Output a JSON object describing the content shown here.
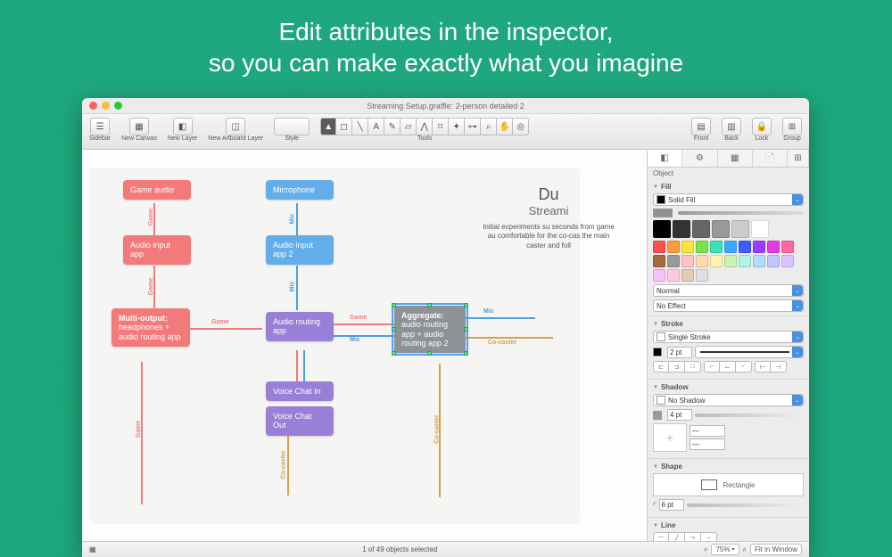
{
  "headline": {
    "line1": "Edit attributes in the inspector,",
    "line2": "so you can make exactly what you imagine"
  },
  "window": {
    "title": "Streaming Setup.graffle: 2-person detailed 2"
  },
  "toolbar": {
    "sidebar": "Sidebar",
    "newCanvas": "New Canvas",
    "newLayer": "New Layer",
    "newArtboard": "New Artboard Layer",
    "style": "Style",
    "tools": "Tools",
    "front": "Front",
    "back": "Back",
    "lock": "Lock",
    "group": "Group"
  },
  "canvas": {
    "nodes": {
      "gameAudio": "Game audio",
      "microphone": "Microphone",
      "audioInput1a": "Audio input",
      "audioInput1b": "app",
      "audioInput2a": "Audio input",
      "audioInput2b": "app 2",
      "multiA": "Multi-output:",
      "multiB": "headphones + audio routing app",
      "routingA": "Audio routing",
      "routingB": "app",
      "aggA": "Aggregate:",
      "aggB": "audio routing app + audio routing app 2",
      "vchatIn": "Voice Chat In",
      "vchatOut": "Voice Chat Out"
    },
    "edges": {
      "game": "Game",
      "mic": "Mic",
      "coCaster": "Co-caster"
    },
    "doc": {
      "h1": "Du",
      "h2": "Streami",
      "p": "Initial experiments su    seconds from game au    comfortable for the co-cas    the main caster and foll"
    }
  },
  "inspector": {
    "label": "Object",
    "fill": {
      "title": "Fill",
      "mode": "Solid Fill",
      "blend": "Normal",
      "effect": "No Effect"
    },
    "stroke": {
      "title": "Stroke",
      "mode": "Single Stroke",
      "width": "2 pt"
    },
    "shadow": {
      "title": "Shadow",
      "mode": "No Shadow",
      "size": "4 pt"
    },
    "shape": {
      "title": "Shape",
      "mode": "Rectangle",
      "radius": "6 pt"
    },
    "line": {
      "title": "Line"
    }
  },
  "palette": {
    "grays": [
      "#000000",
      "#333333",
      "#666666",
      "#999999",
      "#cccccc",
      "#ffffff"
    ],
    "colors": [
      "#ff4d4d",
      "#ff9a3d",
      "#ffe23d",
      "#77e24a",
      "#3de2b5",
      "#3da8ff",
      "#3d5cff",
      "#9a3dff",
      "#e23de2",
      "#ff66a3",
      "#a66a3d",
      "#999999",
      "#ffc2c2",
      "#ffd9b3",
      "#fff3b3",
      "#c9f2b3",
      "#b3f2df",
      "#b3daff",
      "#c0c7ff",
      "#dcc2ff",
      "#f5c2f5",
      "#ffc9dd",
      "#e2cdb3",
      "#e0e0e0"
    ]
  },
  "status": {
    "selection": "1 of 49 objects selected",
    "zoom": "75%",
    "fit": "Fit in Window"
  }
}
